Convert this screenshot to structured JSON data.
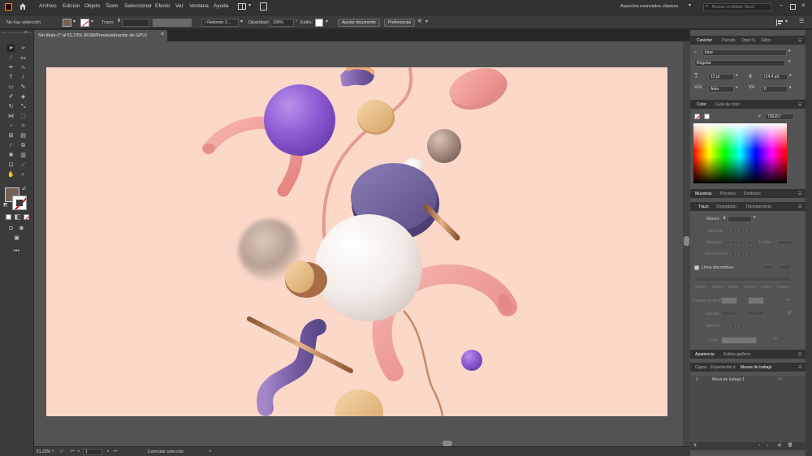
{
  "menubar": {
    "app_icon": "ai-logo-icon",
    "home_icon": "home-icon",
    "menus": [
      "Archivo",
      "Edición",
      "Objeto",
      "Texto",
      "Seleccionar",
      "Efecto",
      "Ver",
      "Ventana",
      "Ayuda"
    ],
    "workspace_switcher": "Aspectos esenciales clásicos",
    "search_placeholder": "Buscar en Adobe Stock"
  },
  "controlbar": {
    "selection_status": "No hay selección",
    "stroke_label": "Trazo:",
    "brush_value": "Redondo 3 ...",
    "opacity_label": "Opacidad:",
    "opacity_value": "100%",
    "style_label": "Estilo:",
    "document_setup_button": "Ajustar documento",
    "preferences_button": "Preferencias"
  },
  "document_tab": {
    "title": "Sin título-1* al 51,23% (RGB/Previsualización de GPU)",
    "close": "×"
  },
  "statusbar": {
    "zoom": "51,23%",
    "angle": "0°",
    "artboard_number": "1",
    "status_text": "Conmutar selección"
  },
  "character_panel": {
    "tabs": [
      "Carácter",
      "Párrafo",
      "OpenTy.",
      "Glifos"
    ],
    "font_family": "Inter",
    "font_style": "Regular",
    "font_size": "12 pt",
    "leading": "(14,4 pt)",
    "kerning": "Auto",
    "tracking": "0"
  },
  "color_panel": {
    "tabs": [
      "Color",
      "Guía de color"
    ],
    "hex_label": "#",
    "hex_value": "756257"
  },
  "swatches_panel": {
    "tabs": [
      "Muestras",
      "Pinceles",
      "Símbolos"
    ]
  },
  "stroke_panel": {
    "tabs": [
      "Trazo",
      "Degradado",
      "Transparencia"
    ],
    "weight_label": "Grosor:",
    "rows": [
      "Remate:",
      "Esquina:",
      "Alinear trazo:"
    ],
    "limit_label": "Límite:",
    "dashed_line_label": "Línea discontinua",
    "dash_headers": [
      "guión",
      "hueco",
      "guión",
      "hueco",
      "guión",
      "hueco"
    ],
    "arrow_labels": [
      "Puntas de flecha:",
      "Escala:",
      "Alinear:"
    ],
    "profile_label": "Perfil:"
  },
  "appearance_panel": {
    "tabs": [
      "Apariencia",
      "Estilos gráficos"
    ]
  },
  "artboards_panel": {
    "tabs": [
      "Capas",
      "Exportación d",
      "Mesas de trabajo"
    ],
    "items": [
      {
        "number": "1",
        "name": "Mesa de trabajo 1"
      }
    ]
  },
  "colors": {
    "artboard_bg": "#fcd8c9",
    "fill_color": "#756257",
    "ui_dark": "#323232",
    "ui_mid": "#535353"
  }
}
